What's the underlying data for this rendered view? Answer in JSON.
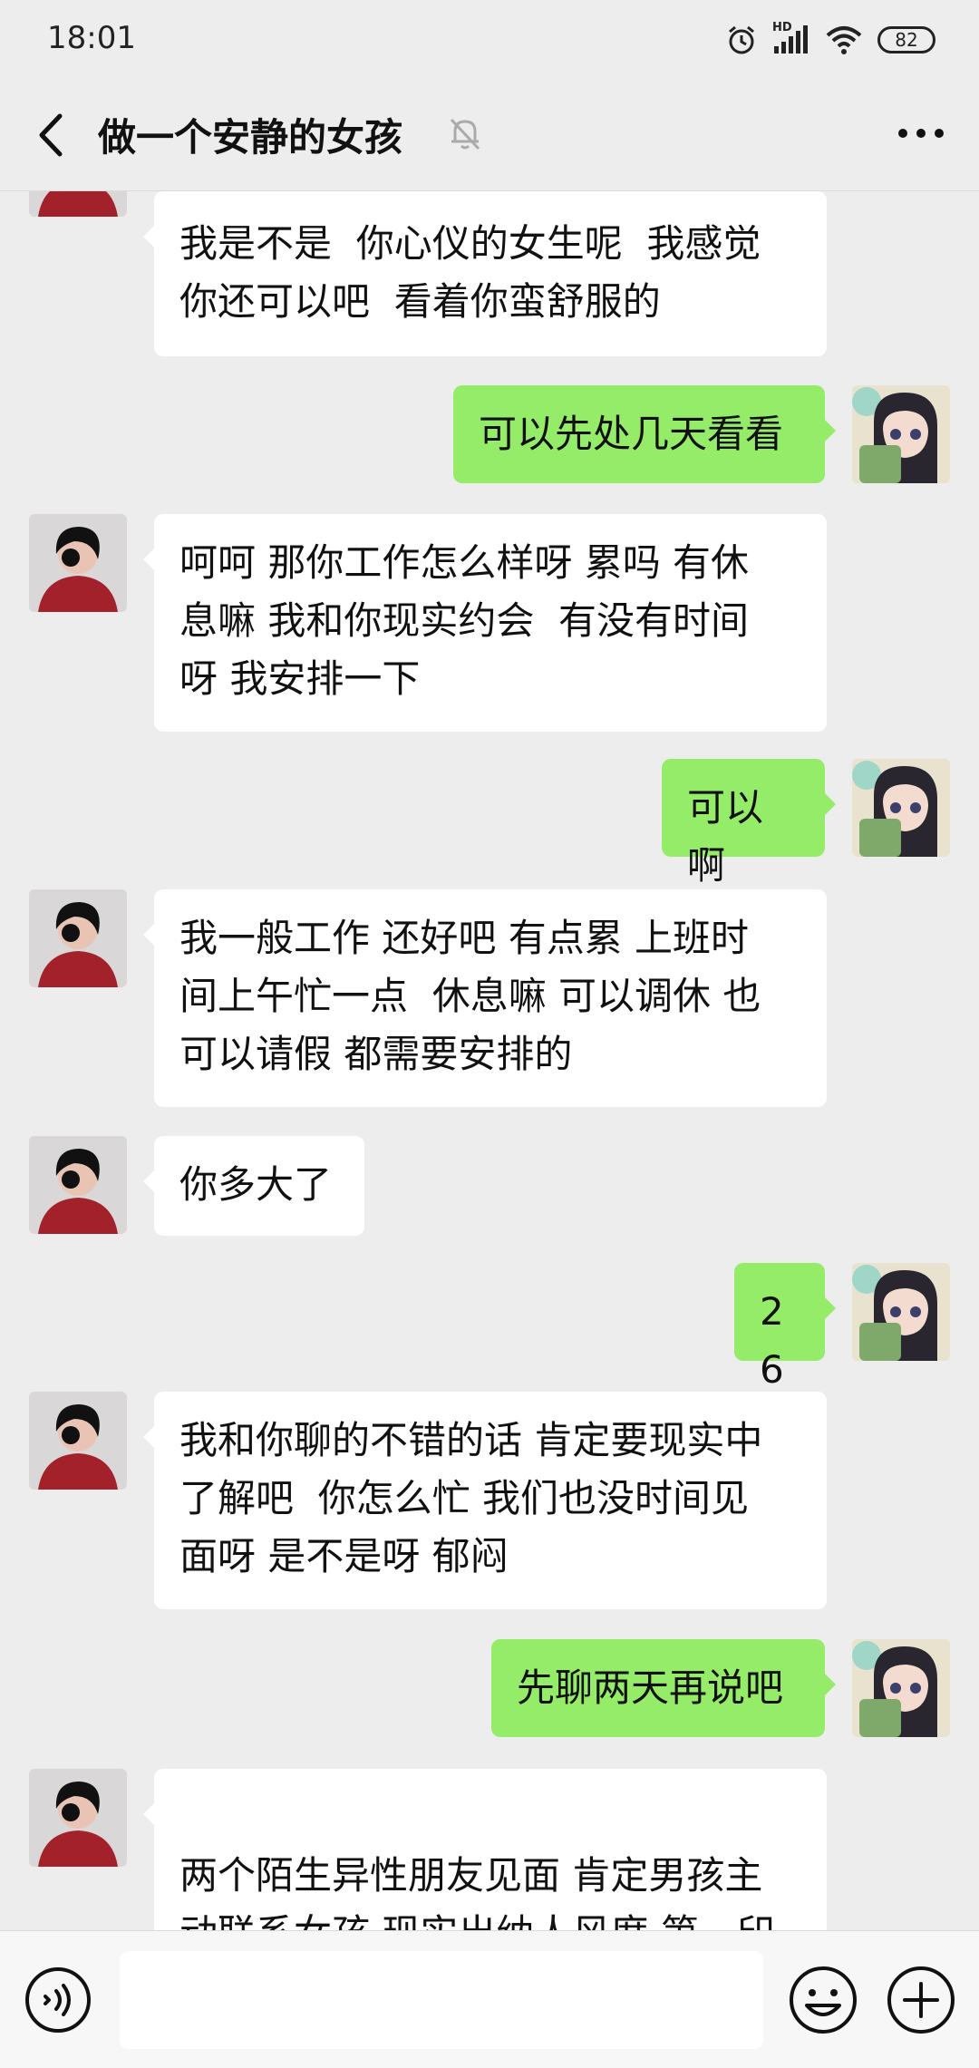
{
  "status_bar": {
    "time": "18:01",
    "network_label": "HD",
    "battery": "82"
  },
  "header": {
    "title": "做一个安静的女孩",
    "icons": {
      "back": "chevron-left-icon",
      "mute": "bell-muted-icon",
      "more": "more-dots-icon"
    }
  },
  "colors": {
    "background": "#ededed",
    "incoming_bubble": "#ffffff",
    "outgoing_bubble": "#95ec69"
  },
  "messages": [
    {
      "side": "left",
      "text": "我是不是  你心仪的女生呢  我感觉\n你还可以吧  看着你蛮舒服的"
    },
    {
      "side": "right",
      "text": "可以先处几天看看"
    },
    {
      "side": "left",
      "text": "呵呵 那你工作怎么样呀 累吗 有休\n息嘛 我和你现实约会  有没有时间\n呀 我安排一下"
    },
    {
      "side": "right",
      "text": "可以啊"
    },
    {
      "side": "left",
      "text": "我一般工作 还好吧 有点累 上班时\n间上午忙一点  休息嘛 可以调休 也\n可以请假 都需要安排的"
    },
    {
      "side": "left",
      "text": "你多大了"
    },
    {
      "side": "right",
      "text": "26"
    },
    {
      "side": "left",
      "text": "我和你聊的不错的话 肯定要现实中\n了解吧  你怎么忙 我们也没时间见\n面呀 是不是呀 郁闷"
    },
    {
      "side": "right",
      "text": "先聊两天再说吧"
    },
    {
      "side": "left",
      "text": "\n两个陌生异性朋友见面 肯定男孩主\n动联系女孩 现实出纳人风度 第一印"
    }
  ],
  "input_bar": {
    "placeholder": "",
    "icons": {
      "voice": "voice-icon",
      "emoji": "emoji-icon",
      "plus": "plus-icon"
    }
  }
}
